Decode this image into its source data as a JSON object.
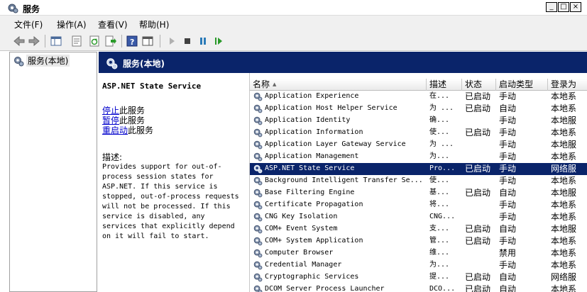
{
  "window": {
    "title": "服务",
    "minimize": "_",
    "maximize": "□",
    "close": "×"
  },
  "menu": [
    "文件(F)",
    "操作(A)",
    "查看(V)",
    "帮助(H)"
  ],
  "tree": {
    "root_label": "服务(本地)"
  },
  "header": {
    "title": "服务(本地)"
  },
  "details": {
    "service_title": "ASP.NET State Service",
    "actions": [
      {
        "link": "停止",
        "suffix": "此服务"
      },
      {
        "link": "暂停",
        "suffix": "此服务"
      },
      {
        "link": "重启动",
        "suffix": "此服务"
      }
    ],
    "description_label": "描述:",
    "description_text": "Provides support for out-of-\nprocess session states for\nASP.NET. If this service is\nstopped, out-of-process requests\nwill not be processed. If this\nservice is disabled, any\nservices that explicitly depend\non it will fail to start."
  },
  "table": {
    "columns": [
      "名称",
      "描述",
      "状态",
      "启动类型",
      "登录为"
    ],
    "rows": [
      {
        "name": "Application Experience",
        "desc": "在...",
        "status": "已启动",
        "startup": "手动",
        "logon": "本地系"
      },
      {
        "name": "Application Host Helper Service",
        "desc": "为 ...",
        "status": "已启动",
        "startup": "自动",
        "logon": "本地系"
      },
      {
        "name": "Application Identity",
        "desc": "确...",
        "status": "",
        "startup": "手动",
        "logon": "本地服"
      },
      {
        "name": "Application Information",
        "desc": "使...",
        "status": "已启动",
        "startup": "手动",
        "logon": "本地系"
      },
      {
        "name": "Application Layer Gateway Service",
        "desc": "为 ...",
        "status": "",
        "startup": "手动",
        "logon": "本地服"
      },
      {
        "name": "Application Management",
        "desc": "为...",
        "status": "",
        "startup": "手动",
        "logon": "本地系"
      },
      {
        "name": "ASP.NET State Service",
        "desc": "Pro...",
        "status": "已启动",
        "startup": "手动",
        "logon": "网络服"
      },
      {
        "name": "Background Intelligent Transfer Se...",
        "desc": "使...",
        "status": "",
        "startup": "手动",
        "logon": "本地系"
      },
      {
        "name": "Base Filtering Engine",
        "desc": "基...",
        "status": "已启动",
        "startup": "自动",
        "logon": "本地服"
      },
      {
        "name": "Certificate Propagation",
        "desc": "将...",
        "status": "",
        "startup": "手动",
        "logon": "本地系"
      },
      {
        "name": "CNG Key Isolation",
        "desc": "CNG...",
        "status": "",
        "startup": "手动",
        "logon": "本地系"
      },
      {
        "name": "COM+ Event System",
        "desc": "支...",
        "status": "已启动",
        "startup": "自动",
        "logon": "本地服"
      },
      {
        "name": "COM+ System Application",
        "desc": "管...",
        "status": "已启动",
        "startup": "手动",
        "logon": "本地系"
      },
      {
        "name": "Computer Browser",
        "desc": "维...",
        "status": "",
        "startup": "禁用",
        "logon": "本地系"
      },
      {
        "name": "Credential Manager",
        "desc": "为...",
        "status": "",
        "startup": "手动",
        "logon": "本地系"
      },
      {
        "name": "Cryptographic Services",
        "desc": "提...",
        "status": "已启动",
        "startup": "自动",
        "logon": "网络服"
      },
      {
        "name": "DCOM Server Process Launcher",
        "desc": "DCO...",
        "status": "已启动",
        "startup": "自动",
        "logon": "本地系"
      }
    ],
    "selected_index": 6,
    "sorted_column": "名称"
  }
}
